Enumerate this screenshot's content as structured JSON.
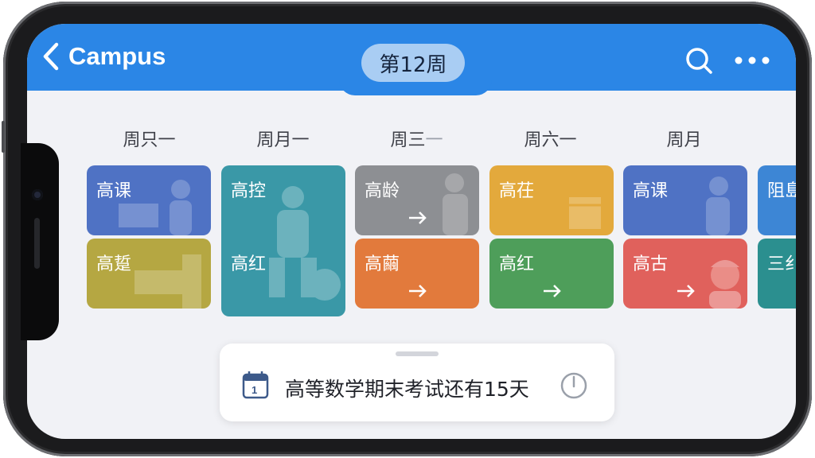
{
  "header": {
    "back_label": "Campus",
    "week_label": "第12周",
    "color": "#2b86e6"
  },
  "days": [
    "周只一",
    "周月一",
    "周三",
    "周六一",
    "周月"
  ],
  "days_note": "",
  "third_day_extra": "一",
  "tiles": {
    "c1_top": {
      "label": "高课",
      "color": "#4f72c4"
    },
    "c1_bot": {
      "label": "高踅",
      "color": "#b5a742"
    },
    "c2_top": {
      "label": "高控",
      "color": "#3a98a7"
    },
    "c2_bot": {
      "label": "高红",
      "color": "#3a98a7"
    },
    "c3_top": {
      "label": "高龄",
      "color": "#8d8f93"
    },
    "c3_bot": {
      "label": "高繭",
      "color": "#e27a3c"
    },
    "c4_top": {
      "label": "高茌",
      "color": "#e3a93c"
    },
    "c4_bot": {
      "label": "高红",
      "color": "#4e9e5a"
    },
    "c5_top": {
      "label": "高课",
      "color": "#4f72c4"
    },
    "c5_bot": {
      "label": "高古",
      "color": "#e0615c"
    },
    "c6_top": {
      "label": "阻島",
      "color": "#3d86d5"
    },
    "c6_bot": {
      "label": "三纟",
      "color": "#2b8f8f"
    }
  },
  "notice": {
    "text": "高等数学期末考试还有15天",
    "icon_left": "calendar-icon",
    "icon_right": "timer-icon"
  },
  "icons": [
    "back-chevron-icon",
    "search-icon",
    "more-icon",
    "arrow-right-icon"
  ]
}
